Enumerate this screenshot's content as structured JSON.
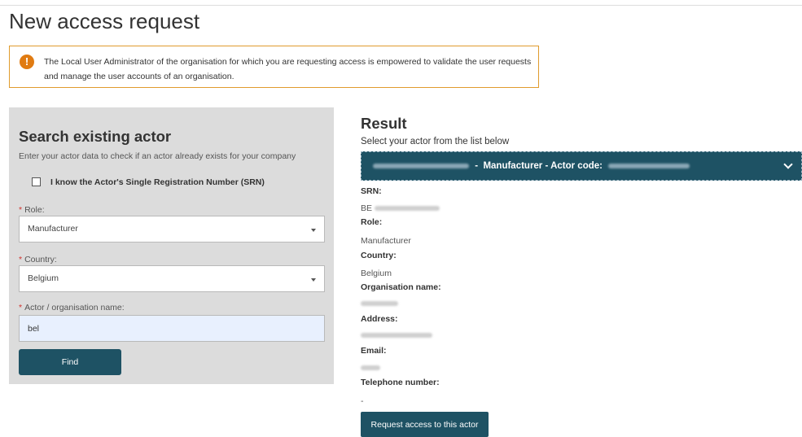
{
  "page": {
    "title": "New access request",
    "notice": "The Local User Administrator of the organisation for which you are requesting access is empowered to validate the user requests and manage the user accounts of an organisation."
  },
  "search": {
    "title": "Search existing actor",
    "hint": "Enter your actor data to check if an actor already exists for your company",
    "srn_checkbox_label": "I know the Actor's Single Registration Number (SRN)",
    "srn_checked": false,
    "required_mark": "*",
    "role_label": "Role:",
    "role_value": "Manufacturer",
    "country_label": "Country:",
    "country_value": "Belgium",
    "name_label": "Actor / organisation name:",
    "name_value": "bel",
    "find_label": "Find"
  },
  "result": {
    "title": "Result",
    "hint": "Select your actor from the list below",
    "selected_actor": {
      "separator": "-",
      "role_text": "Manufacturer - Actor code:"
    },
    "srn_label": "SRN:",
    "srn_prefix": "BE",
    "role_label": "Role:",
    "role_value": "Manufacturer",
    "country_label": "Country:",
    "country_value": "Belgium",
    "org_label": "Organisation name:",
    "address_label": "Address:",
    "email_label": "Email:",
    "phone_label": "Telephone number:",
    "phone_value": "-",
    "request_label": "Request access to this actor"
  },
  "colors": {
    "accent": "#1e5264",
    "notice_border": "#e09b2d",
    "notice_icon": "#e07b12",
    "panel_bg": "#dcdcdc",
    "required": "#d1342f"
  },
  "icons": {
    "notice": "exclamation-icon",
    "dropdown": "caret-down-icon",
    "actor_select": "chevron-down-icon"
  }
}
